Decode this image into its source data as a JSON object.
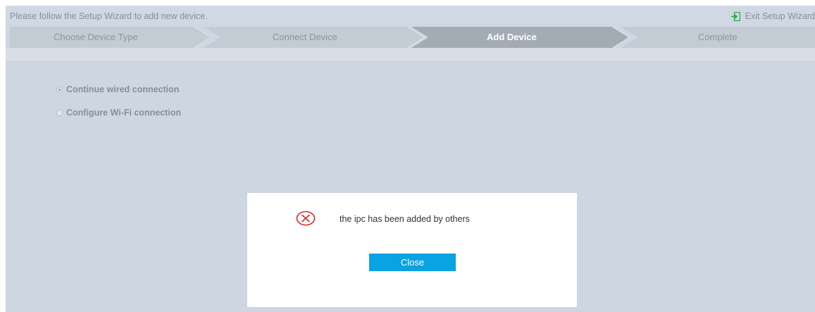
{
  "wizard": {
    "instruction": "Please follow the Setup Wizard to add new device.",
    "exit_label": "Exit Setup Wizard",
    "exit_icon": "exit-arrow-icon",
    "steps": [
      {
        "label": "Choose Device Type",
        "state": "done"
      },
      {
        "label": "Connect Device",
        "state": "done"
      },
      {
        "label": "Add Device",
        "state": "active"
      },
      {
        "label": "Complete",
        "state": "pending"
      }
    ],
    "options": [
      {
        "label": "Continue wired connection",
        "selected": true
      },
      {
        "label": "Configure Wi-Fi connection",
        "selected": false
      }
    ]
  },
  "dialog": {
    "icon": "error-circle-x-icon",
    "message": "the ipc has been added by others",
    "close_label": "Close"
  },
  "colors": {
    "background": "#cdd6e1",
    "active_step": "#a3abb4",
    "inactive_step": "#c3cbd5",
    "button_accent": "#0aa3e2",
    "error_red": "#e0262b",
    "exit_icon_green": "#2fa84f"
  }
}
